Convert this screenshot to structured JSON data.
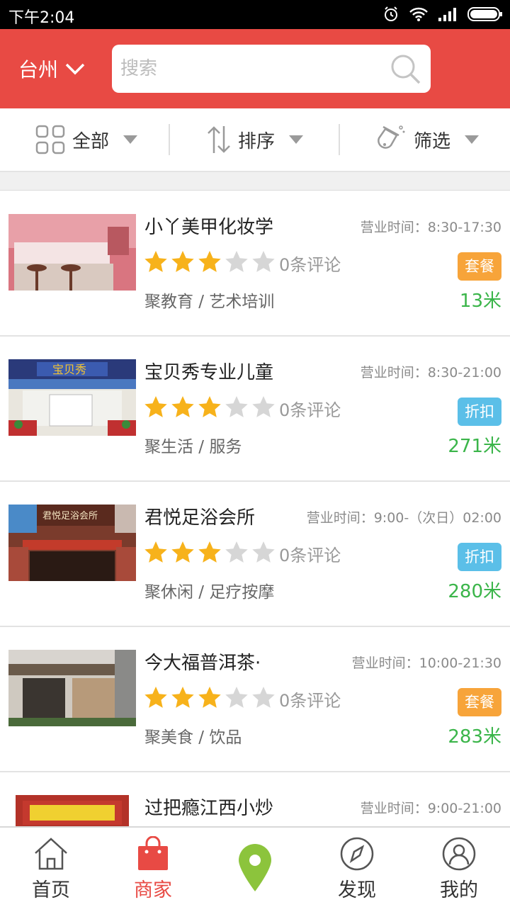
{
  "status_bar": {
    "time": "下午2:04"
  },
  "header": {
    "city": "台州",
    "search_placeholder": "搜索"
  },
  "filters": [
    {
      "label": "全部",
      "icon": "grid-icon"
    },
    {
      "label": "排序",
      "icon": "sort-arrows-icon"
    },
    {
      "label": "筛选",
      "icon": "flask-icon"
    }
  ],
  "merchants": [
    {
      "name": "小丫美甲化妆学",
      "hours": "营业时间：8:30-17:30",
      "rating": 3,
      "reviews": "0条评论",
      "category": "聚教育 / 艺术培训",
      "tag": "套餐",
      "tag_color": "#f7a43a",
      "distance": "13米"
    },
    {
      "name": "宝贝秀专业儿童",
      "hours": "营业时间：8:30-21:00",
      "rating": 3,
      "reviews": "0条评论",
      "category": "聚生活 / 服务",
      "tag": "折扣",
      "tag_color": "#5bbfe8",
      "distance": "271米"
    },
    {
      "name": "君悦足浴会所",
      "hours": "营业时间：9:00-（次日）02:00",
      "rating": 3,
      "reviews": "0条评论",
      "category": "聚休闲 / 足疗按摩",
      "tag": "折扣",
      "tag_color": "#5bbfe8",
      "distance": "280米"
    },
    {
      "name": "今大福普洱茶·",
      "hours": "营业时间：10:00-21:30",
      "rating": 3,
      "reviews": "0条评论",
      "category": "聚美食 / 饮品",
      "tag": "套餐",
      "tag_color": "#f7a43a",
      "distance": "283米"
    },
    {
      "name": "过把瘾江西小炒",
      "hours": "营业时间：9:00-21:00",
      "rating": 3,
      "reviews": "0条评论",
      "category": "",
      "tag": "",
      "tag_color": "#f7a43a",
      "distance": ""
    }
  ],
  "bottom_nav": [
    {
      "label": "首页",
      "icon": "home-icon"
    },
    {
      "label": "商家",
      "icon": "shopping-bag-icon",
      "active": true
    },
    {
      "label": "",
      "icon": "map-pin-icon"
    },
    {
      "label": "发现",
      "icon": "compass-icon"
    },
    {
      "label": "我的",
      "icon": "user-icon"
    }
  ],
  "colors": {
    "brand": "#e84a44",
    "star": "#f7b21b",
    "star_off": "#d6d6d6",
    "distance": "#3bb54a"
  }
}
